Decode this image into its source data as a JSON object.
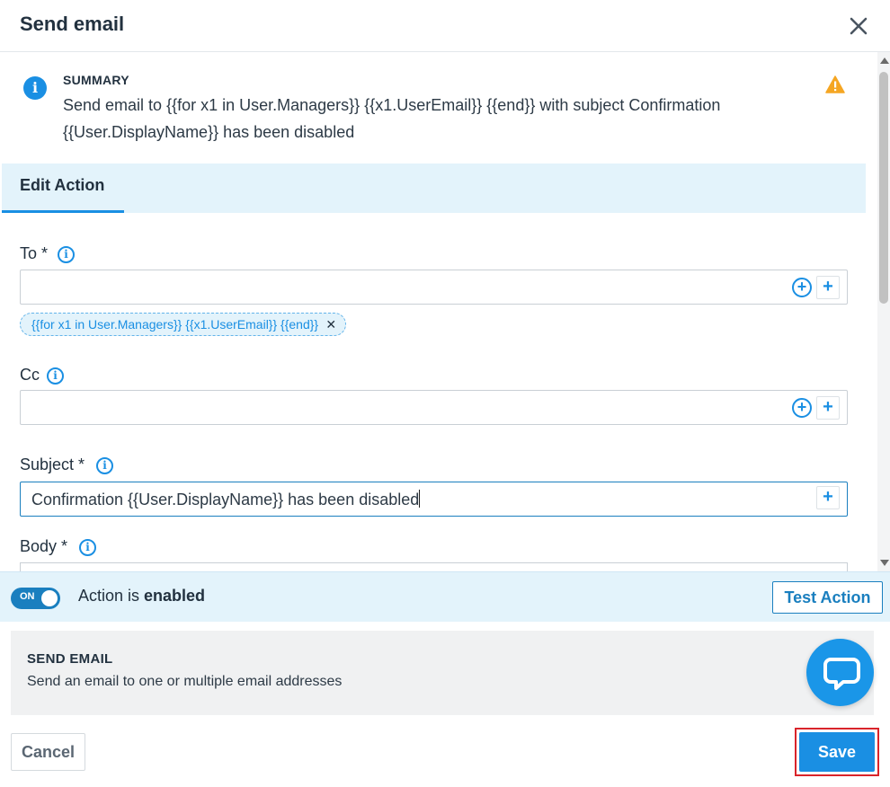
{
  "dialog": {
    "title": "Send email"
  },
  "summary": {
    "label": "SUMMARY",
    "text": "Send email to {{for x1 in User.Managers}} {{x1.UserEmail}} {{end}} with subject Confirmation {{User.DisplayName}} has been disabled"
  },
  "tabs": [
    {
      "label": "Edit Action",
      "active": true
    }
  ],
  "form": {
    "to": {
      "label": "To *",
      "value": "",
      "chips": [
        {
          "label": "{{for x1 in User.Managers}} {{x1.UserEmail}} {{end}}",
          "remove_glyph": "✕"
        }
      ]
    },
    "cc": {
      "label": "Cc",
      "value": ""
    },
    "subject": {
      "label": "Subject *",
      "value": "Confirmation {{User.DisplayName}} has been disabled"
    },
    "body": {
      "label": "Body *"
    },
    "add_glyph": "+"
  },
  "status": {
    "toggle_label": "ON",
    "text_prefix": "Action is ",
    "text_state": "enabled",
    "test_button": "Test Action"
  },
  "description": {
    "title": "SEND EMAIL",
    "text": "Send an email to one or multiple email addresses"
  },
  "footer": {
    "cancel": "Cancel",
    "save": "Save"
  },
  "icons": {
    "info": "i",
    "close": "close-icon",
    "warning": "warning-icon",
    "chat": "chat-icon"
  },
  "colors": {
    "accent": "#1a8fe3",
    "tab_bg": "#e3f3fb",
    "warning": "#f5a623",
    "highlight": "#d9242a"
  }
}
